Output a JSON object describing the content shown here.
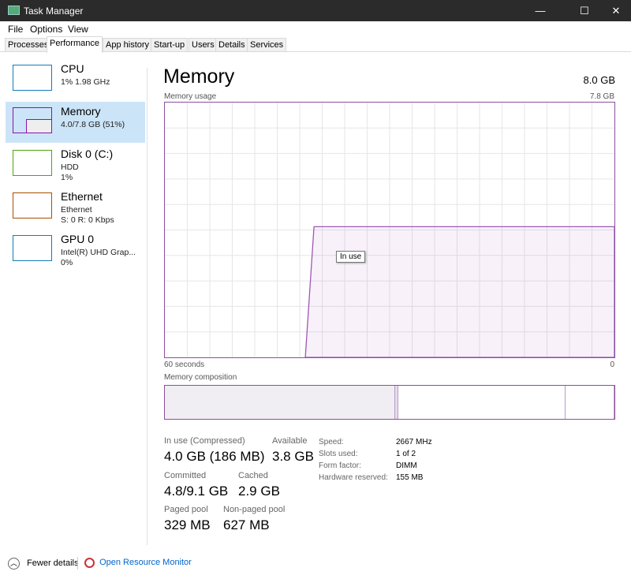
{
  "window": {
    "title": "Task Manager",
    "minimize": "—",
    "maximize": "☐",
    "close": "✕"
  },
  "menu": [
    "File",
    "Options",
    "View"
  ],
  "tabs": [
    "Processes",
    "Performance",
    "App history",
    "Start-up",
    "Users",
    "Details",
    "Services"
  ],
  "active_tab": "Performance",
  "sidebar": [
    {
      "name": "CPU",
      "line1": "1% 1.98 GHz",
      "line2": "",
      "color": "#117dbb"
    },
    {
      "name": "Memory",
      "line1": "4.0/7.8 GB (51%)",
      "line2": "",
      "color": "#8b12ae",
      "selected": true
    },
    {
      "name": "Disk 0 (C:)",
      "line1": "HDD",
      "line2": "1%",
      "color": "#4da60c"
    },
    {
      "name": "Ethernet",
      "line1": "Ethernet",
      "line2": "S: 0 R: 0 Kbps",
      "color": "#a74f01"
    },
    {
      "name": "GPU 0",
      "line1": "Intel(R) UHD Grap...",
      "line2": "0%",
      "color": "#117dbb"
    }
  ],
  "main": {
    "title": "Memory",
    "total": "8.0 GB",
    "usage_label": "Memory usage",
    "usage_max": "7.8 GB",
    "time_left": "60 seconds",
    "time_right": "0",
    "tooltip": "In use",
    "composition_label": "Memory composition",
    "usage_history_gb": {
      "before": 0,
      "after": 4.0,
      "jump_at_fraction_of_window": 0.33
    },
    "composition_gb": {
      "in_use": 4.0,
      "modified": 0.05,
      "standby": 2.9,
      "free": 0.85
    },
    "stats": [
      {
        "label": "In use (Compressed)",
        "value": "4.0 GB (186 MB)"
      },
      {
        "label": "Available",
        "value": "3.8 GB"
      },
      {
        "label": "Committed",
        "value": "4.8/9.1 GB"
      },
      {
        "label": "Cached",
        "value": "2.9 GB"
      },
      {
        "label": "Paged pool",
        "value": "329 MB"
      },
      {
        "label": "Non-paged pool",
        "value": "627 MB"
      }
    ],
    "details": [
      {
        "key": "Speed:",
        "value": "2667 MHz"
      },
      {
        "key": "Slots used:",
        "value": "1 of 2"
      },
      {
        "key": "Form factor:",
        "value": "DIMM"
      },
      {
        "key": "Hardware reserved:",
        "value": "155 MB"
      }
    ]
  },
  "footer": {
    "fewer": "Fewer details",
    "monitor": "Open Resource Monitor"
  }
}
